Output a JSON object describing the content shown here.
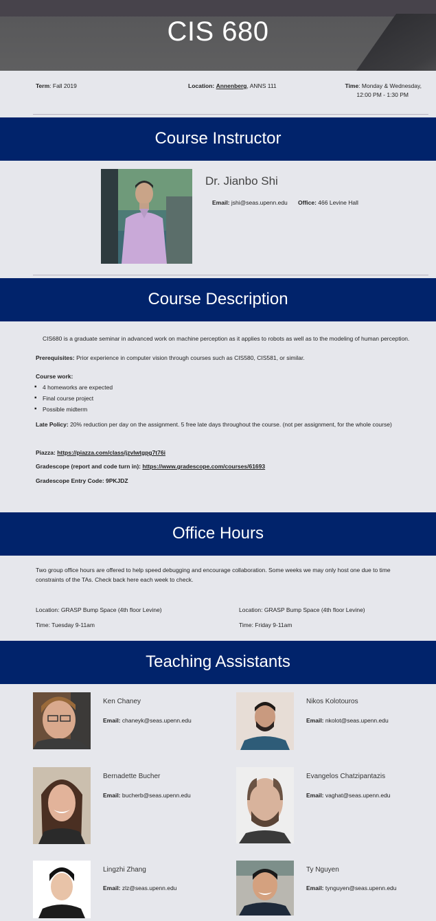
{
  "hero": {
    "title": "CIS 680"
  },
  "info": {
    "term_label": "Term",
    "term_value": ": Fall 2019",
    "location_label": "Location:",
    "location_link": "Annenberg",
    "location_value": ", ANNS 111",
    "time_label": "Time",
    "time_value_1": ": Monday & Wednesday,",
    "time_value_2": "12:00 PM - 1:30 PM"
  },
  "sections": {
    "instructor": "Course Instructor",
    "description": "Course Description",
    "office_hours": "Office Hours",
    "tas": "Teaching Assistants"
  },
  "instructor": {
    "name": "Dr. Jianbo Shi",
    "email_label": "Email:",
    "email": "jshi@seas.upenn.edu",
    "office_label": "Office:",
    "office": "466 Levine Hall"
  },
  "description": {
    "intro": "CIS680 is a graduate seminar in advanced work on machine perception as it applies to robots as well as to the modeling of human perception.",
    "prereq_label": "Prerequisites:",
    "prereq": " Prior experience in computer vision through courses such as CIS580, CIS581, or similar.",
    "coursework_label": "Course work:",
    "coursework_items": [
      "4 homeworks are expected",
      "Final course project",
      "Possible midterm"
    ],
    "late_label": "Late Policy:",
    "late": " 20% reduction per day on the assignment. 5 free late days throughout the course. (not per assignment, for the whole course)",
    "piazza_label": "Piazza: ",
    "piazza_link": "https://piazza.com/class/jzvlwtgpg7t76i",
    "gradescope_label": "Gradescope (report and code turn in): ",
    "gradescope_link": "https://www.gradescope.com/courses/61693",
    "entry_code": "Gradescope Entry Code: 9PKJDZ"
  },
  "office_hours": {
    "intro": "Two group office hours are offered to help speed debugging and encourage collaboration. Some weeks we may only host one due to time constraints of the TAs. Check back here each week to check.",
    "slots": [
      {
        "location": "Location: GRASP Bump Space (4th floor Levine)",
        "time": "Time: Tuesday 9-11am"
      },
      {
        "location": "Location: GRASP Bump Space (4th floor Levine)",
        "time": "Time: Friday 9-11am"
      }
    ]
  },
  "tas": [
    {
      "name": "Ken Chaney",
      "email_label": "Email:",
      "email": "chaneyk@seas.upenn.edu"
    },
    {
      "name": "Nikos Kolotouros",
      "email_label": "Email:",
      "email": "nkolot@seas.upenn.edu"
    },
    {
      "name": "Bernadette Bucher",
      "email_label": "Email:",
      "email": "bucherb@seas.upenn.edu"
    },
    {
      "name": "Evangelos Chatzipantazis",
      "email_label": "Email:",
      "email": "vaghat@seas.upenn.edu"
    },
    {
      "name": "Lingzhi Zhang",
      "email_label": "Email:",
      "email": "zlz@seas.upenn.edu"
    },
    {
      "name": "Ty Nguyen",
      "email_label": "Email:",
      "email": "tynguyen@seas.upenn.edu"
    }
  ],
  "colors": {
    "band": "#01236b",
    "page": "#e6e7ec",
    "hero": "#5a5a5c"
  }
}
